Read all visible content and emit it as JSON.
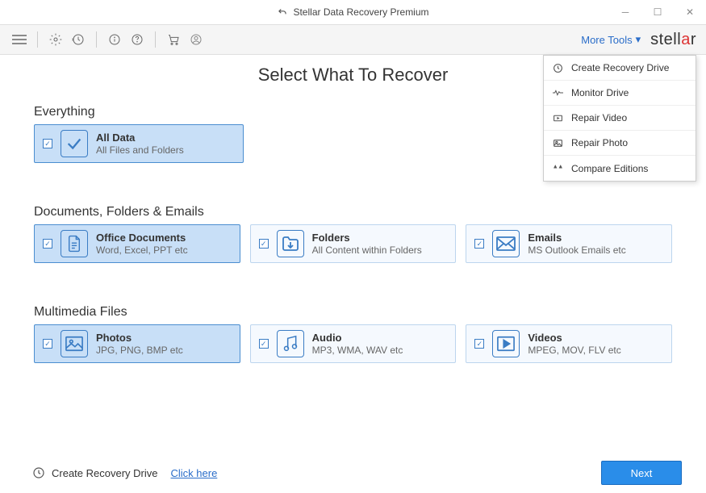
{
  "window_title": "Stellar Data Recovery Premium",
  "toolbar": {
    "more_tools": "More Tools",
    "brand": "stellar"
  },
  "dropdown": {
    "items": [
      "Create Recovery Drive",
      "Monitor Drive",
      "Repair Video",
      "Repair Photo",
      "Compare Editions"
    ]
  },
  "page_title": "Select What To Recover",
  "sections": {
    "everything": {
      "label": "Everything",
      "card": {
        "title": "All Data",
        "sub": "All Files and Folders"
      }
    },
    "documents": {
      "label": "Documents, Folders & Emails",
      "cards": [
        {
          "title": "Office Documents",
          "sub": "Word, Excel, PPT etc"
        },
        {
          "title": "Folders",
          "sub": "All Content within Folders"
        },
        {
          "title": "Emails",
          "sub": "MS Outlook Emails etc"
        }
      ]
    },
    "multimedia": {
      "label": "Multimedia Files",
      "cards": [
        {
          "title": "Photos",
          "sub": "JPG, PNG, BMP etc"
        },
        {
          "title": "Audio",
          "sub": "MP3, WMA, WAV etc"
        },
        {
          "title": "Videos",
          "sub": "MPEG, MOV, FLV etc"
        }
      ]
    }
  },
  "footer": {
    "label": "Create Recovery Drive",
    "link": "Click here",
    "next": "Next"
  }
}
